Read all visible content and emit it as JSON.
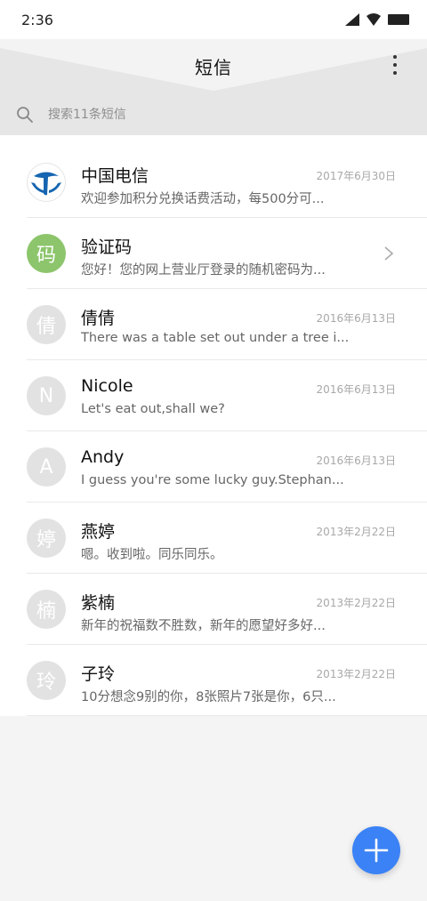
{
  "status_bar": {
    "time": "2:36"
  },
  "header": {
    "title": "短信"
  },
  "search": {
    "placeholder": "搜索11条短信"
  },
  "messages": [
    {
      "name": "中国电信",
      "preview": "欢迎参加积分兑换话费活动，每500分可...",
      "date": "2017年6月30日",
      "avatar_type": "logo",
      "avatar_text": ""
    },
    {
      "name": "验证码",
      "preview": "您好！您的网上营业厅登录的随机密码为...",
      "date": "",
      "avatar_type": "green",
      "avatar_text": "码"
    },
    {
      "name": "倩倩",
      "preview": "There was a table set out under a tree i...",
      "date": "2016年6月13日",
      "avatar_type": "gray",
      "avatar_text": "倩"
    },
    {
      "name": "Nicole",
      "preview": "Let's eat out,shall we?",
      "date": "2016年6月13日",
      "avatar_type": "gray",
      "avatar_text": "N"
    },
    {
      "name": "Andy",
      "preview": "I guess you're some lucky guy.Stephan...",
      "date": "2016年6月13日",
      "avatar_type": "gray",
      "avatar_text": "A"
    },
    {
      "name": "燕婷",
      "preview": "嗯。收到啦。同乐同乐。",
      "date": "2013年2月22日",
      "avatar_type": "gray",
      "avatar_text": "婷"
    },
    {
      "name": "紫楠",
      "preview": "新年的祝福数不胜数，新年的愿望好多好...",
      "date": "2013年2月22日",
      "avatar_type": "gray",
      "avatar_text": "楠"
    },
    {
      "name": "子玲",
      "preview": "10分想念9别的你，8张照片7张是你，6只...",
      "date": "2013年2月22日",
      "avatar_type": "gray",
      "avatar_text": "玲"
    }
  ],
  "colors": {
    "fab": "#3b82f6",
    "avatar_green": "#8cc56b",
    "avatar_gray": "#e2e2e2",
    "telecom_blue": "#1565b0"
  },
  "icons": {
    "search": "search-icon",
    "more": "more-vertical-icon",
    "compose": "plus-icon",
    "chevron": "chevron-right-icon"
  }
}
